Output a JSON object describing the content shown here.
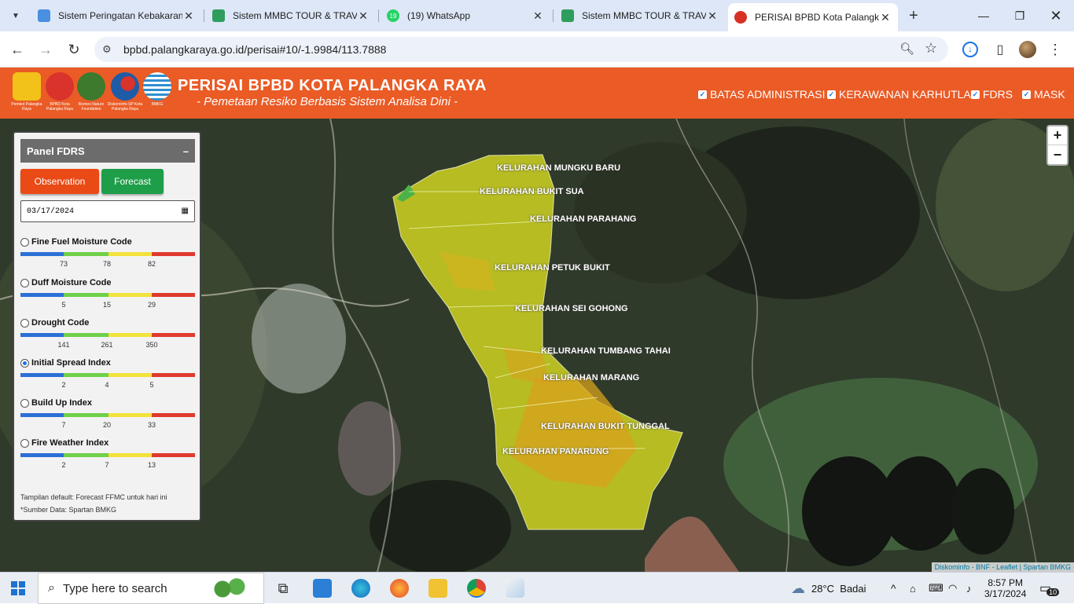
{
  "browser": {
    "tabs": [
      {
        "title": "Sistem Peringatan Kebakaran",
        "favicon_color": "#4a8fe0",
        "active": false
      },
      {
        "title": "Sistem MMBC TOUR & TRAV",
        "favicon_color": "#2e9e5e",
        "active": false
      },
      {
        "title": "(19) WhatsApp",
        "favicon_color": "#25d366",
        "badge": "19",
        "active": false
      },
      {
        "title": "Sistem MMBC TOUR & TRAV",
        "favicon_color": "#2e9e5e",
        "active": false
      },
      {
        "title": "PERISAI BPBD Kota Palangka",
        "favicon_color": "#d93025",
        "active": true
      }
    ],
    "url": "bpbd.palangkaraya.go.id/perisai#10/-1.9984/113.7888"
  },
  "header": {
    "title": "PERISAI BPBD KOTA PALANGKA RAYA",
    "subtitle": "- Pemetaan Resiko Berbasis Sistem Analisa Dini -",
    "logos": [
      {
        "caption": "Pemkot Palangka Raya",
        "color": "#f2c21b"
      },
      {
        "caption": "BPBD Kota Palangka Raya",
        "color": "#d9332b"
      },
      {
        "caption": "Borneo Nature Foundation",
        "color": "#3d7a2e"
      },
      {
        "caption": "Diskominfo-SP Kota Palangka Raya",
        "color": "#1f5ca8"
      },
      {
        "caption": "BMKG",
        "color": "#2f8fcf"
      }
    ],
    "layers": [
      {
        "label": "BATAS ADMINISTRASI",
        "checked": true
      },
      {
        "label": "KERAWANAN KARHUTLA",
        "checked": true
      },
      {
        "label": "FDRS",
        "checked": true
      },
      {
        "label": "MASK",
        "checked": true
      }
    ]
  },
  "panel": {
    "title": "Panel FDRS",
    "collapse": "–",
    "observation_label": "Observation",
    "forecast_label": "Forecast",
    "date_value": "03/17/2024",
    "indices": [
      {
        "label": "Fine Fuel Moisture Code",
        "ticks": [
          "73",
          "78",
          "82"
        ],
        "selected": false
      },
      {
        "label": "Duff Moisture Code",
        "ticks": [
          "5",
          "15",
          "29"
        ],
        "selected": false
      },
      {
        "label": "Drought Code",
        "ticks": [
          "141",
          "261",
          "350"
        ],
        "selected": false
      },
      {
        "label": "Initial Spread Index",
        "ticks": [
          "2",
          "4",
          "5"
        ],
        "selected": true
      },
      {
        "label": "Build Up Index",
        "ticks": [
          "7",
          "20",
          "33"
        ],
        "selected": false
      },
      {
        "label": "Fire Weather Index",
        "ticks": [
          "2",
          "7",
          "13"
        ],
        "selected": false
      }
    ],
    "scale_colors": [
      "#2c6fd6",
      "#6fd04a",
      "#f3e23a",
      "#e03a2f"
    ],
    "note_default": "Tampilan default: Forecast FFMC untuk hari ini",
    "note_source": "*Sumber Data: Spartan BMKG"
  },
  "map": {
    "kelurahan": [
      "KELURAHAN MUNGKU BARU",
      "KELURAHAN BUKIT SUA",
      "KELURAHAN PARAHANG",
      "KELURAHAN PETUK BUKIT",
      "KELURAHAN SEI GOHONG",
      "KELURAHAN TUMBANG TAHAI",
      "KELURAHAN MARANG",
      "KELURAHAN BUKIT TUNGGAL",
      "KELURAHAN PANARUNG"
    ],
    "zoom_in": "+",
    "zoom_out": "−",
    "attribution": "Diskominfo - BNF - Leaflet | Spartan BMKG"
  },
  "taskbar": {
    "search_placeholder": "Type here to search",
    "weather": "28°C  Badai",
    "time": "8:57 PM",
    "date": "3/17/2024",
    "notifications": "10"
  }
}
